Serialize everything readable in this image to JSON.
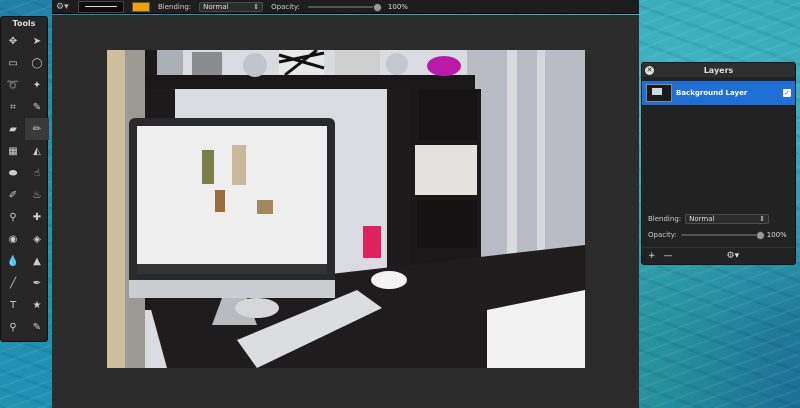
{
  "toolbar": {
    "blending_label": "Blending:",
    "blending_value": "Normal",
    "opacity_label": "Opacity:",
    "opacity_value": "100%",
    "opacity_fraction": 1.0,
    "primary_color": "#f0a000"
  },
  "tools_panel": {
    "title": "Tools",
    "items": [
      "move-icon",
      "select-arrow-icon",
      "rect-select-icon",
      "ellipse-select-icon",
      "lasso-icon",
      "magic-wand-icon",
      "crop-icon",
      "eyedropper-icon",
      "eraser-icon",
      "brush-icon",
      "gradient-icon",
      "paint-bucket-icon",
      "shape-icon",
      "smudge-icon",
      "pencil-icon",
      "burn-icon",
      "stamp-icon",
      "heal-icon",
      "eye-icon",
      "sponge-icon",
      "drop-icon",
      "sharpen-icon",
      "line-icon",
      "pen-icon",
      "text-icon",
      "star-icon",
      "zoom-icon",
      "color-picker-icon"
    ]
  },
  "layers_panel": {
    "title": "Layers",
    "layer_name": "Background Layer",
    "blending_label": "Blending:",
    "blending_value": "Normal",
    "opacity_label": "Opacity:",
    "opacity_value": "100%",
    "opacity_fraction": 1.0
  },
  "icons": {
    "gear": "gear-icon",
    "close": "close-icon",
    "add": "add-icon",
    "remove": "remove-icon"
  }
}
